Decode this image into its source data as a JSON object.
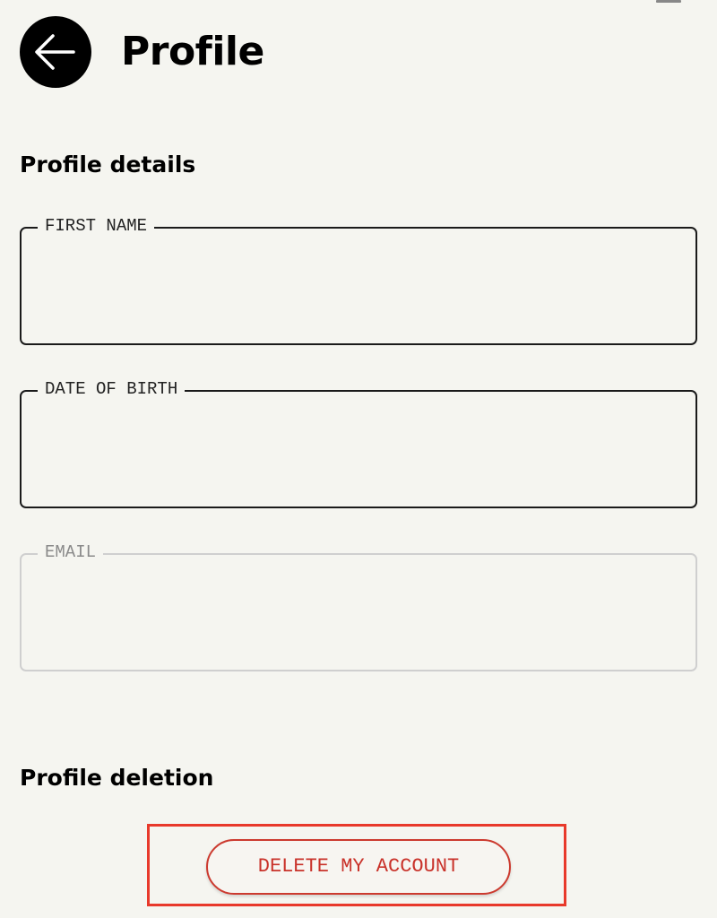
{
  "header": {
    "title": "Profile",
    "back_icon": "arrow-left-icon"
  },
  "details_section": {
    "heading": "Profile details",
    "fields": {
      "first_name": {
        "label": "FIRST NAME",
        "value": ""
      },
      "date_of_birth": {
        "label": "DATE OF BIRTH",
        "value": ""
      },
      "email": {
        "label": "EMAIL",
        "value": "",
        "disabled": true
      }
    }
  },
  "deletion_section": {
    "heading": "Profile deletion",
    "delete_label": "DELETE MY ACCOUNT"
  },
  "colors": {
    "background": "#f5f5f0",
    "delete_accent": "#c9322a",
    "highlight": "#e8392b"
  }
}
